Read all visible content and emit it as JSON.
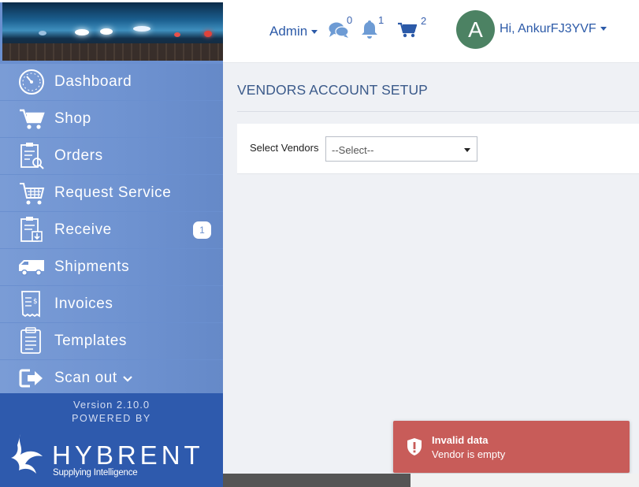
{
  "header": {
    "admin_label": "Admin",
    "messages_count": "0",
    "notifications_count": "1",
    "cart_count": "2",
    "avatar_letter": "A",
    "greeting": "Hi, AnkurFJ3YVF"
  },
  "sidebar": {
    "items": [
      {
        "label": "Dashboard",
        "icon": "dashboard-icon"
      },
      {
        "label": "Shop",
        "icon": "cart-icon"
      },
      {
        "label": "Orders",
        "icon": "orders-icon"
      },
      {
        "label": "Request Service",
        "icon": "request-service-icon"
      },
      {
        "label": "Receive",
        "icon": "receive-icon",
        "badge": "1"
      },
      {
        "label": "Shipments",
        "icon": "truck-icon"
      },
      {
        "label": "Invoices",
        "icon": "invoice-icon"
      },
      {
        "label": "Templates",
        "icon": "templates-icon"
      },
      {
        "label": "Scan out",
        "icon": "sign-out-icon",
        "chevron": "chevron-down-icon"
      }
    ],
    "version": "Version 2.10.0",
    "powered_by": "POWERED BY",
    "logo_text": "HYBRENT",
    "logo_tagline": "Supplying Intelligence"
  },
  "main": {
    "title": "VENDORS ACCOUNT SETUP",
    "select_label": "Select Vendors",
    "select_value": "--Select--"
  },
  "toast": {
    "title": "Invalid data",
    "message": "Vendor is empty"
  },
  "colors": {
    "accent": "#2c5aa8",
    "sidebar": "#6a8fcf",
    "sidebar_footer": "#2e5aad",
    "avatar": "#4c8263",
    "toast_error": "#c85c59"
  }
}
